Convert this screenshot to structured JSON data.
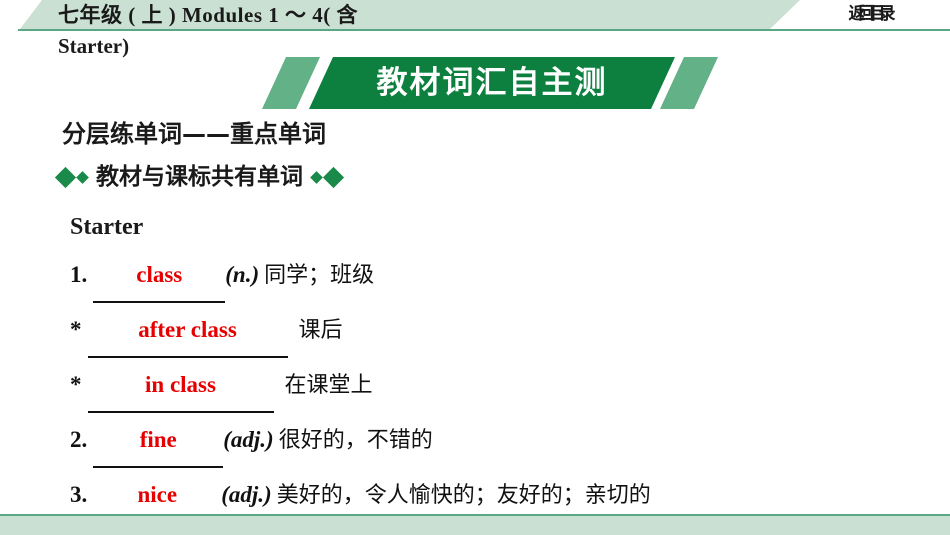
{
  "header": {
    "title_line1": "七年级 ( 上 ) Modules 1 ～ 4( 含",
    "title_line2": "Starter)",
    "back_button_label": "返回目录"
  },
  "banner": {
    "label": "教材词汇自主测"
  },
  "sections": {
    "section_heading": "分层练单词——重点单词",
    "subsection_heading": "教材与课标共有单词",
    "group_label": "Starter"
  },
  "entries": [
    {
      "marker": "1.",
      "answer": "class",
      "pos": "(n.)",
      "meaning": "同学；班级"
    },
    {
      "marker": "*",
      "answer": "after class",
      "pos": "",
      "meaning": "课后"
    },
    {
      "marker": "*",
      "answer": "in class",
      "pos": "",
      "meaning": "在课堂上"
    },
    {
      "marker": "2.",
      "answer": "fine",
      "pos": "(adj.)",
      "meaning": "很好的，不错的"
    },
    {
      "marker": "3.",
      "answer": "nice",
      "pos": "(adj.)",
      "meaning": "美好的，令人愉快的；友好的；亲切的"
    }
  ],
  "colors": {
    "banner_green": "#0d8040",
    "accent_light_green": "#c9e0d2",
    "deco_green": "#63b186",
    "answer_red": "#e60000"
  }
}
